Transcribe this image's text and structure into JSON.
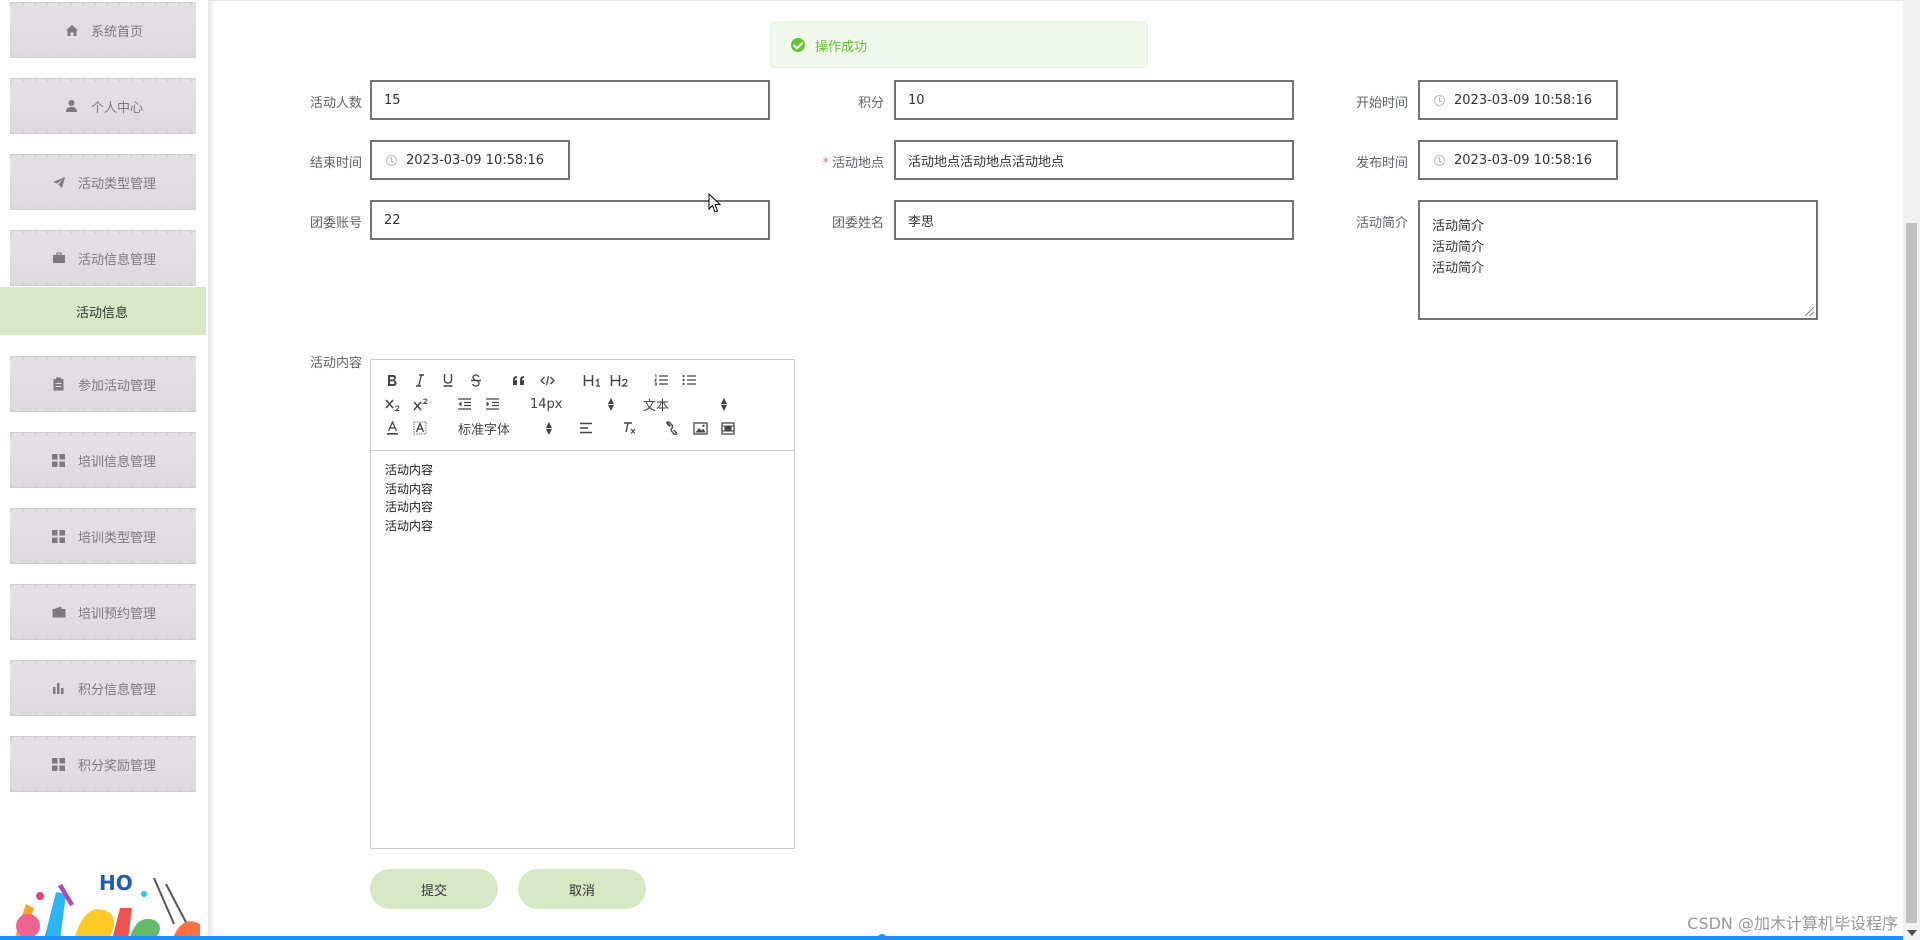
{
  "sidebar": {
    "items": [
      {
        "label": "系统首页",
        "icon": "home-icon"
      },
      {
        "label": "个人中心",
        "icon": "user-icon"
      },
      {
        "label": "活动类型管理",
        "icon": "paper-plane-icon"
      },
      {
        "label": "活动信息管理",
        "icon": "briefcase-icon"
      },
      {
        "label": "参加活动管理",
        "icon": "clipboard-icon"
      },
      {
        "label": "培训信息管理",
        "icon": "grid-icon"
      },
      {
        "label": "培训类型管理",
        "icon": "grid-icon"
      },
      {
        "label": "培训预约管理",
        "icon": "wallet-icon"
      },
      {
        "label": "积分信息管理",
        "icon": "bar-chart-icon"
      },
      {
        "label": "积分奖励管理",
        "icon": "grid-icon"
      }
    ],
    "active_submenu": "活动信息"
  },
  "toast": {
    "message": "操作成功",
    "color": "#67c23a"
  },
  "form": {
    "participants": {
      "label": "活动人数",
      "value": "15"
    },
    "points": {
      "label": "积分",
      "value": "10"
    },
    "start_time": {
      "label": "开始时间",
      "value": "2023-03-09 10:58:16"
    },
    "end_time": {
      "label": "结束时间",
      "value": "2023-03-09 10:58:16"
    },
    "location": {
      "label": "活动地点",
      "value": "活动地点活动地点活动地点",
      "required": "*"
    },
    "publish_time": {
      "label": "发布时间",
      "value": "2023-03-09 10:58:16"
    },
    "league_account": {
      "label": "团委账号",
      "value": "22"
    },
    "league_name": {
      "label": "团委姓名",
      "value": "李思"
    },
    "intro": {
      "label": "活动简介",
      "value": "活动简介\n活动简介\n活动简介"
    },
    "content": {
      "label": "活动内容",
      "value": "活动内容\n活动内容\n活动内容\n活动内容"
    }
  },
  "editor": {
    "font_size": "14px",
    "header_select": "文本",
    "font_family": "标准字体"
  },
  "buttons": {
    "submit": "提交",
    "cancel": "取消"
  },
  "watermark": "CSDN @加木计算机毕设程序",
  "colors": {
    "accent": "#d6e8c6",
    "success": "#67c23a",
    "required": "#f56c6c"
  }
}
